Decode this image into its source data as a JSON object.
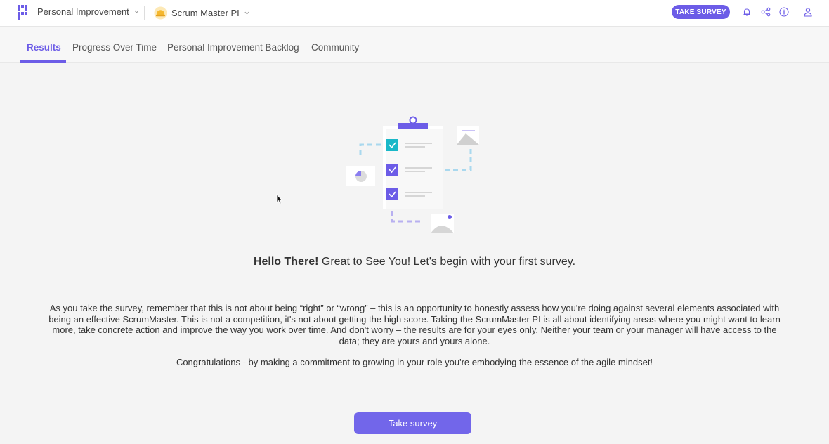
{
  "header": {
    "workspace_label": "Personal Improvement",
    "product_label": "Scrum Master PI",
    "take_survey_label": "TAKE SURVEY",
    "icons": [
      "logo-icon",
      "bell-icon",
      "share-icon",
      "info-icon",
      "user-icon"
    ],
    "accent_color": "#6c5ce7"
  },
  "tabs": [
    {
      "label": "Results",
      "active": true
    },
    {
      "label": "Progress Over Time",
      "active": false
    },
    {
      "label": "Personal Improvement Backlog",
      "active": false
    },
    {
      "label": "Community",
      "active": false
    }
  ],
  "main": {
    "greeting_bold": "Hello There!",
    "greeting_rest": " Great to See You! Let's begin with your first survey.",
    "paragraph": "As you take the survey, remember that this is not about being “right” or “wrong” – this is an opportunity to honestly assess how you're doing against several elements associated with being an effective ScrumMaster. This is not a competition, it's not about getting the high score. Taking the ScrumMaster PI is all about identifying areas where you might want to learn more, take concrete action and improve the way you work over time. And don't worry – the results are for your eyes only. Neither your team or your manager will have access to the data; they are yours and yours alone.",
    "congrats": "Congratulations - by making a commitment to growing in your role you're embodying the essence of the agile mindset!",
    "button_label": "Take survey"
  }
}
